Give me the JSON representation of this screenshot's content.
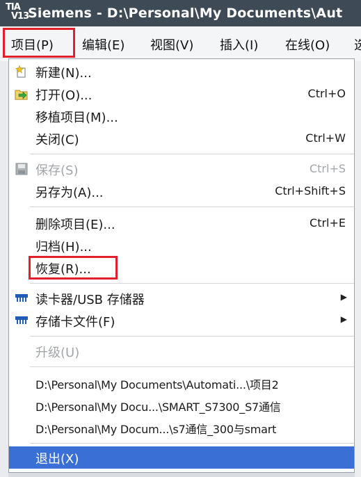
{
  "window": {
    "logo_line1": "TIA",
    "logo_line2": "V13",
    "title": "Siemens  -  D:\\Personal\\My Documents\\Aut"
  },
  "menubar": {
    "items": [
      {
        "label": "项目(P)"
      },
      {
        "label": "编辑(E)"
      },
      {
        "label": "视图(V)"
      },
      {
        "label": "插入(I)"
      },
      {
        "label": "在线(O)"
      },
      {
        "label": "选"
      }
    ]
  },
  "project_menu": {
    "new": {
      "label": "新建(N)...",
      "icon": "new-project-icon"
    },
    "open": {
      "label": "打开(O)...",
      "shortcut": "Ctrl+O",
      "icon": "open-folder-icon"
    },
    "migrate": {
      "label": "移植项目(M)..."
    },
    "close": {
      "label": "关闭(C)",
      "shortcut": "Ctrl+W"
    },
    "save": {
      "label": "保存(S)",
      "shortcut": "Ctrl+S",
      "icon": "save-disk-icon",
      "enabled": false
    },
    "save_as": {
      "label": "另存为(A)...",
      "shortcut": "Ctrl+Shift+S"
    },
    "delete": {
      "label": "删除项目(E)...",
      "shortcut": "Ctrl+E"
    },
    "archive": {
      "label": "归档(H)..."
    },
    "restore": {
      "label": "恢复(R)..."
    },
    "card_reader": {
      "label": "读卡器/USB 存储器",
      "icon": "card-reader-icon"
    },
    "memory_card_file": {
      "label": "存储卡文件(F)",
      "icon": "memory-card-icon"
    },
    "upgrade": {
      "label": "升级(U)",
      "enabled": false
    },
    "recent": [
      "D:\\Personal\\My Documents\\Automati...\\项目2",
      "D:\\Personal\\My Docu...\\SMART_S7300_S7通信",
      "D:\\Personal\\My Docum...\\s7通信_300与smart"
    ],
    "exit": {
      "label": "退出(X)"
    }
  },
  "colors": {
    "titlebar": "#3e4a55",
    "highlight_box": "#e0202a",
    "selection": "#3a6fd6"
  }
}
